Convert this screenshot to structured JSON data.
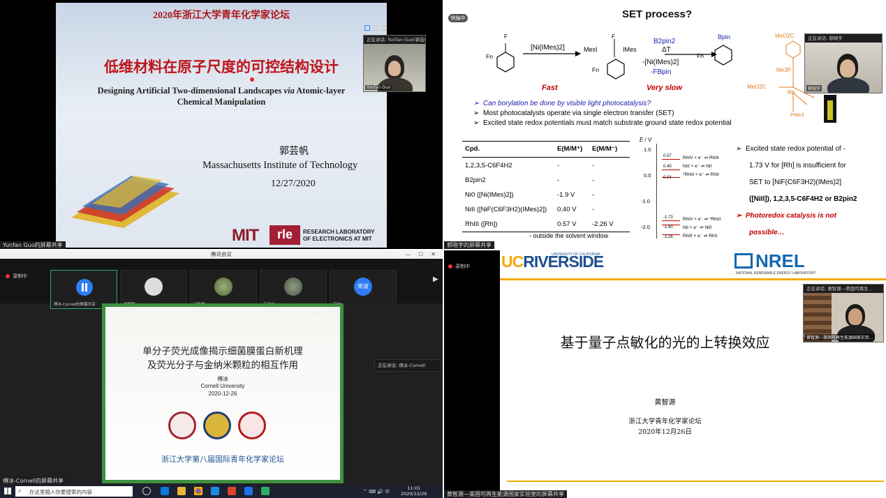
{
  "q1": {
    "forum": "2020年浙江大学青年化学家论坛",
    "title_cn": "低维材料在原子尺度的可控结构设计",
    "title_en_1": "Designing Artificial Two-dimensional Landscapes ",
    "title_en_via": "via",
    "title_en_2": " Atomic-layer",
    "title_en_3": "Chemical Manipulation",
    "speaker_cn": "郭芸帆",
    "institution": "Massachusetts Institute of Technology",
    "date": "12/27/2020",
    "logo_mit": "MIT",
    "logo_rle": "rle",
    "lab_1": "RESEARCH LABORATORY",
    "lab_2": "OF ELECTRONICS AT MIT",
    "cam_speaking": "正在讲话: Yunfan Guo(郭芸帆)",
    "cam_name": "Yunfan Guo",
    "share_label": "Yunfan Guo的屏幕共享"
  },
  "q2": {
    "title": "SET process?",
    "badge": "快抽中",
    "catalyst": "[Ni(IMes)2]",
    "mesi": "MesI",
    "imes": "IMes",
    "f": "F",
    "fn": "Fn",
    "reagent": "B2pin2",
    "delta": "ΔT",
    "byproduct1": "-[Ni(IMes)2]",
    "byproduct2": "-FBpin",
    "bpin": "Bpin",
    "fast": "Fast",
    "slow": "Very slow",
    "b1": "Can borylation be done by visible light photocatalysis?",
    "b2": "Most photocatalysts operate via single electron transfer (SET)",
    "b3": "Excited state redox potentials must match substrate ground state redox potential",
    "col_cpd": "Cpd.",
    "col_e1": "E(M/M⁺)",
    "col_e2": "E(M/M⁻)",
    "rows": [
      {
        "cpd": "1,2,3,5-C6F4H2",
        "e1": "-",
        "e2": "-"
      },
      {
        "cpd": "B2pin2",
        "e1": "-",
        "e2": "-"
      },
      {
        "cpd": "Ni0 ([Ni(IMes)2])",
        "e1": "-1.9 V",
        "e2": "-"
      },
      {
        "cpd": "NiII ([NiF(C6F3H2)(IMes)2])",
        "e1": "0.40 V",
        "e2": "-"
      },
      {
        "cpd": "RhIII ([Rh])",
        "e1": "0.57 V",
        "e2": "-2.26 V"
      }
    ],
    "footnote": "- outside the solvent window",
    "axis_label": "E / V",
    "ticks": [
      "1.0",
      "0.0",
      "-1.0",
      "-2.0"
    ],
    "levels_top": [
      {
        "v": "0.57",
        "t": "RhIV + e⁻ ⇌ RhIII"
      },
      {
        "v": "0.40",
        "t": "NiII + e⁻ ⇌ NiI"
      },
      {
        "v": "0.04",
        "t": "*RhIII + e⁻ ⇌ RhII"
      }
    ],
    "levels_bottom": [
      {
        "v": "-1.73",
        "t": "RhIV + e⁻ ⇌ *RhIII"
      },
      {
        "v": "-1.90",
        "t": "NiI + e⁻ ⇌ Ni0"
      },
      {
        "v": "-2.26",
        "t": "RhIII + e⁻ ⇌ RhII"
      }
    ],
    "r1": "Excited state redox potential of -",
    "r2": "1.73 V for [Rh] is insufficient for",
    "r3": "SET to [NiF(C6F3H2)(IMes)2]",
    "r4": "([NiII]), 1,2,3,5-C6F4H2 or B2pin2",
    "r5": "Photoredox catalysis is not",
    "r6": "possible…",
    "meo2c": "MeO2C",
    "me3p": "Me3P",
    "rh": "Rh",
    "pme3": "PMe3",
    "cam_speaking": "正在讲话: 郭晓宇",
    "cam_name": "郭晓宇",
    "share_label": "郭晓宇的屏幕共享"
  },
  "q3": {
    "window_title": "腾讯会议",
    "rec": "录制中",
    "thumbs": [
      "傅冰-Cornell的屏幕共享",
      "侯刚刚",
      "丁智峰",
      "王利广",
      "宋波"
    ],
    "avatar_text": "宋波",
    "title_1": "单分子荧光成像揭示细菌膜蛋白新机理",
    "title_2": "及荧光分子与金纳米颗粒的相互作用",
    "speaker": "傅冰",
    "uni": "Cornell University",
    "date": "2020-12-26",
    "forum": "浙江大学第八届国际青年化学家论坛",
    "speaking": "正在讲话: 傅冰-Cornell",
    "search": "在这里输入你要搜索的内容",
    "time": "11:01",
    "date2": "2020/12/26",
    "share_label": "傅冰-Cornell的屏幕共享"
  },
  "q4": {
    "rec": "录制中",
    "ucr_uc": "UC",
    "ucr_riverside": "RIVERSIDE",
    "ucr_small": "UNIVERSITY OF CALIFORNIA",
    "nrel": "NREL",
    "nrel_small": "NATIONAL RENEWABLE ENERGY LABORATORY",
    "title": "基于量子点敏化的光的上转换效应",
    "speaker": "黄智源",
    "forum": "浙江大学青年化学家论坛",
    "date": "2020年12月26日",
    "cam_speaking": "正在讲话: 黄智源—美国可再生…",
    "cam_name": "黄智源—美国可再生能源国家实验…",
    "share_label": "黄智源—美国可再生能源国家实验室的屏幕共享"
  }
}
